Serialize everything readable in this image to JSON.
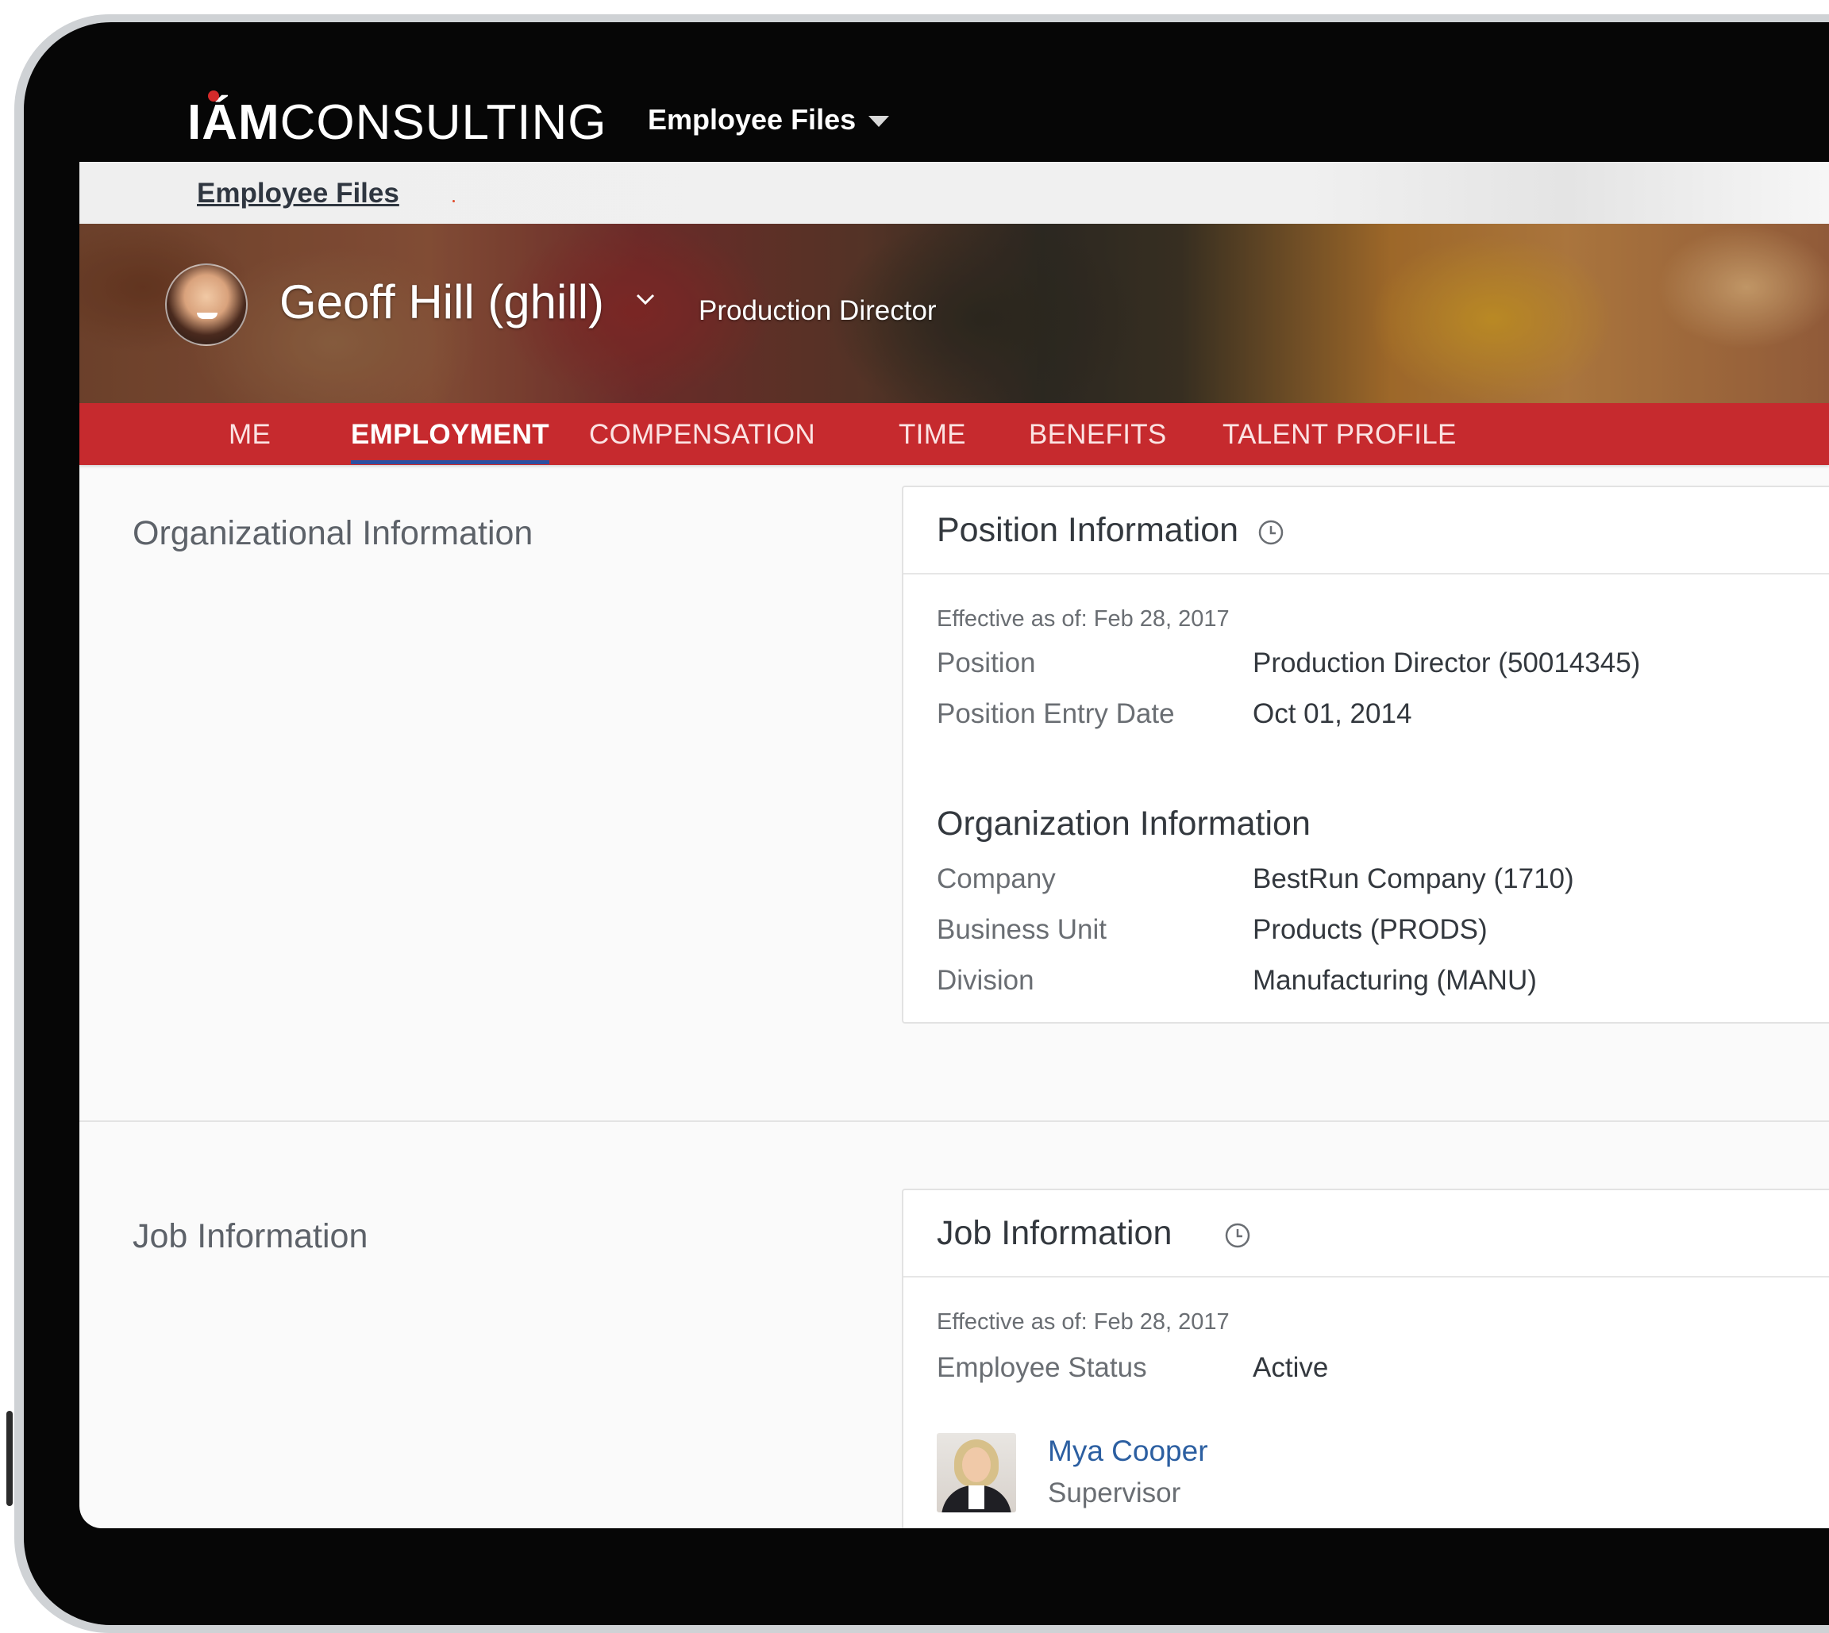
{
  "brand": {
    "bold": "IÁM",
    "light": "CONSULTING"
  },
  "module_menu": {
    "label": "Employee Files"
  },
  "breadcrumb": {
    "label": "Employee Files"
  },
  "employee": {
    "name": "Geoff Hill (ghill)",
    "title": "Production Director"
  },
  "tabs": [
    {
      "label": "ME"
    },
    {
      "label": "EMPLOYMENT"
    },
    {
      "label": "COMPENSATION"
    },
    {
      "label": "TIME"
    },
    {
      "label": "BENEFITS"
    },
    {
      "label": "TALENT PROFILE"
    }
  ],
  "active_tab": "EMPLOYMENT",
  "sections": {
    "org": {
      "label": "Organizational Information"
    },
    "job": {
      "label": "Job Information"
    }
  },
  "position_card": {
    "title": "Position Information",
    "effective": "Effective as of: Feb 28, 2017",
    "rows": [
      {
        "label": "Position",
        "value": "Production Director (50014345)"
      },
      {
        "label": "Position Entry Date",
        "value": "Oct 01, 2014"
      }
    ],
    "org_subtitle": "Organization Information",
    "org_rows": [
      {
        "label": "Company",
        "value": "BestRun Company (1710)"
      },
      {
        "label": "Business Unit",
        "value": "Products (PRODS)"
      },
      {
        "label": "Division",
        "value": "Manufacturing (MANU)"
      }
    ]
  },
  "job_card": {
    "title": "Job Information",
    "effective": "Effective as of: Feb 28, 2017",
    "rows": [
      {
        "label": "Employee Status",
        "value": "Active"
      }
    ],
    "supervisor": {
      "name": "Mya Cooper",
      "role": "Supervisor"
    }
  },
  "colors": {
    "tab_bar": "#c62a2e",
    "tab_underline": "#2c4fa1",
    "link": "#2c5fa1",
    "top_bar": "#060606"
  },
  "icons": [
    "chevron-down-icon",
    "history-icon",
    "caret-down-icon"
  ]
}
